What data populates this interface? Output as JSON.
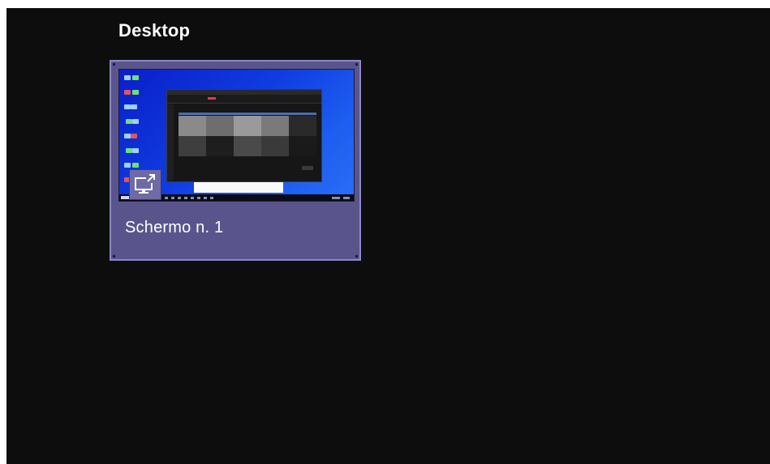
{
  "section": {
    "title": "Desktop"
  },
  "screens": [
    {
      "label": "Schermo n. 1",
      "icon": "screen-share-icon"
    }
  ],
  "colors": {
    "background": "#0d0d0d",
    "card_background": "#59558c",
    "card_border": "#8c88c8",
    "text": "#ffffff"
  }
}
